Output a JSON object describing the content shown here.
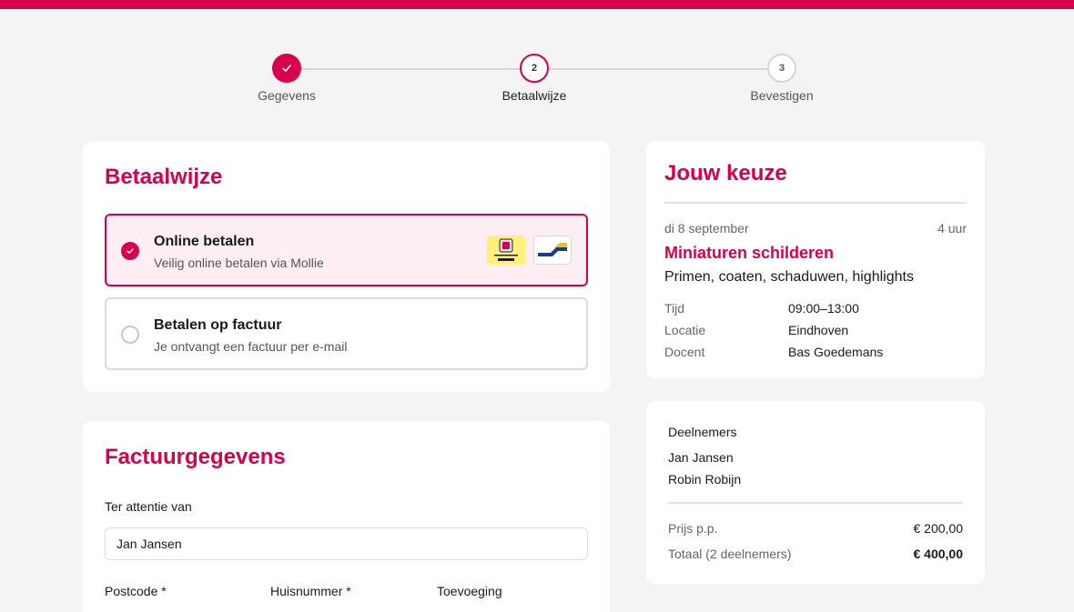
{
  "stepper": {
    "steps": [
      {
        "label": "Gegevens",
        "marker": "✓",
        "state": "done"
      },
      {
        "label": "Betaalwijze",
        "marker": "2",
        "state": "active"
      },
      {
        "label": "Bevestigen",
        "marker": "3",
        "state": "todo"
      }
    ]
  },
  "payment": {
    "title": "Betaalwijze",
    "options": [
      {
        "title": "Online betalen",
        "subtitle": "Veilig online betalen via Mollie",
        "selected": true,
        "logos": [
          "wero-logo",
          "bancontact-logo"
        ]
      },
      {
        "title": "Betalen op factuur",
        "subtitle": "Je ontvangt een factuur per e-mail",
        "selected": false
      }
    ]
  },
  "billing": {
    "title": "Factuurgegevens",
    "attention_label": "Ter attentie van",
    "attention_value": "Jan Jansen",
    "postcode_label": "Postcode *",
    "housenumber_label": "Huisnummer *",
    "addition_label": "Toevoeging"
  },
  "summary": {
    "title": "Jouw keuze",
    "date": "di 8 september",
    "duration": "4 uur",
    "course_title": "Miniaturen schilderen",
    "course_subtitle": "Primen, coaten, schaduwen, highlights",
    "details": [
      {
        "label": "Tijd",
        "value": "09:00–13:00"
      },
      {
        "label": "Locatie",
        "value": "Eindhoven"
      },
      {
        "label": "Docent",
        "value": "Bas Goedemans"
      }
    ]
  },
  "participants": {
    "heading": "Deelnemers",
    "names": [
      "Jan Jansen",
      "Robin Robijn"
    ],
    "price_label": "Prijs p.p.",
    "price_value": "€ 200,00",
    "total_label": "Totaal (2 deelnemers)",
    "total_value": "€ 400,00"
  },
  "colors": {
    "accent": "#d8004c",
    "background": "#f4f4f4"
  }
}
